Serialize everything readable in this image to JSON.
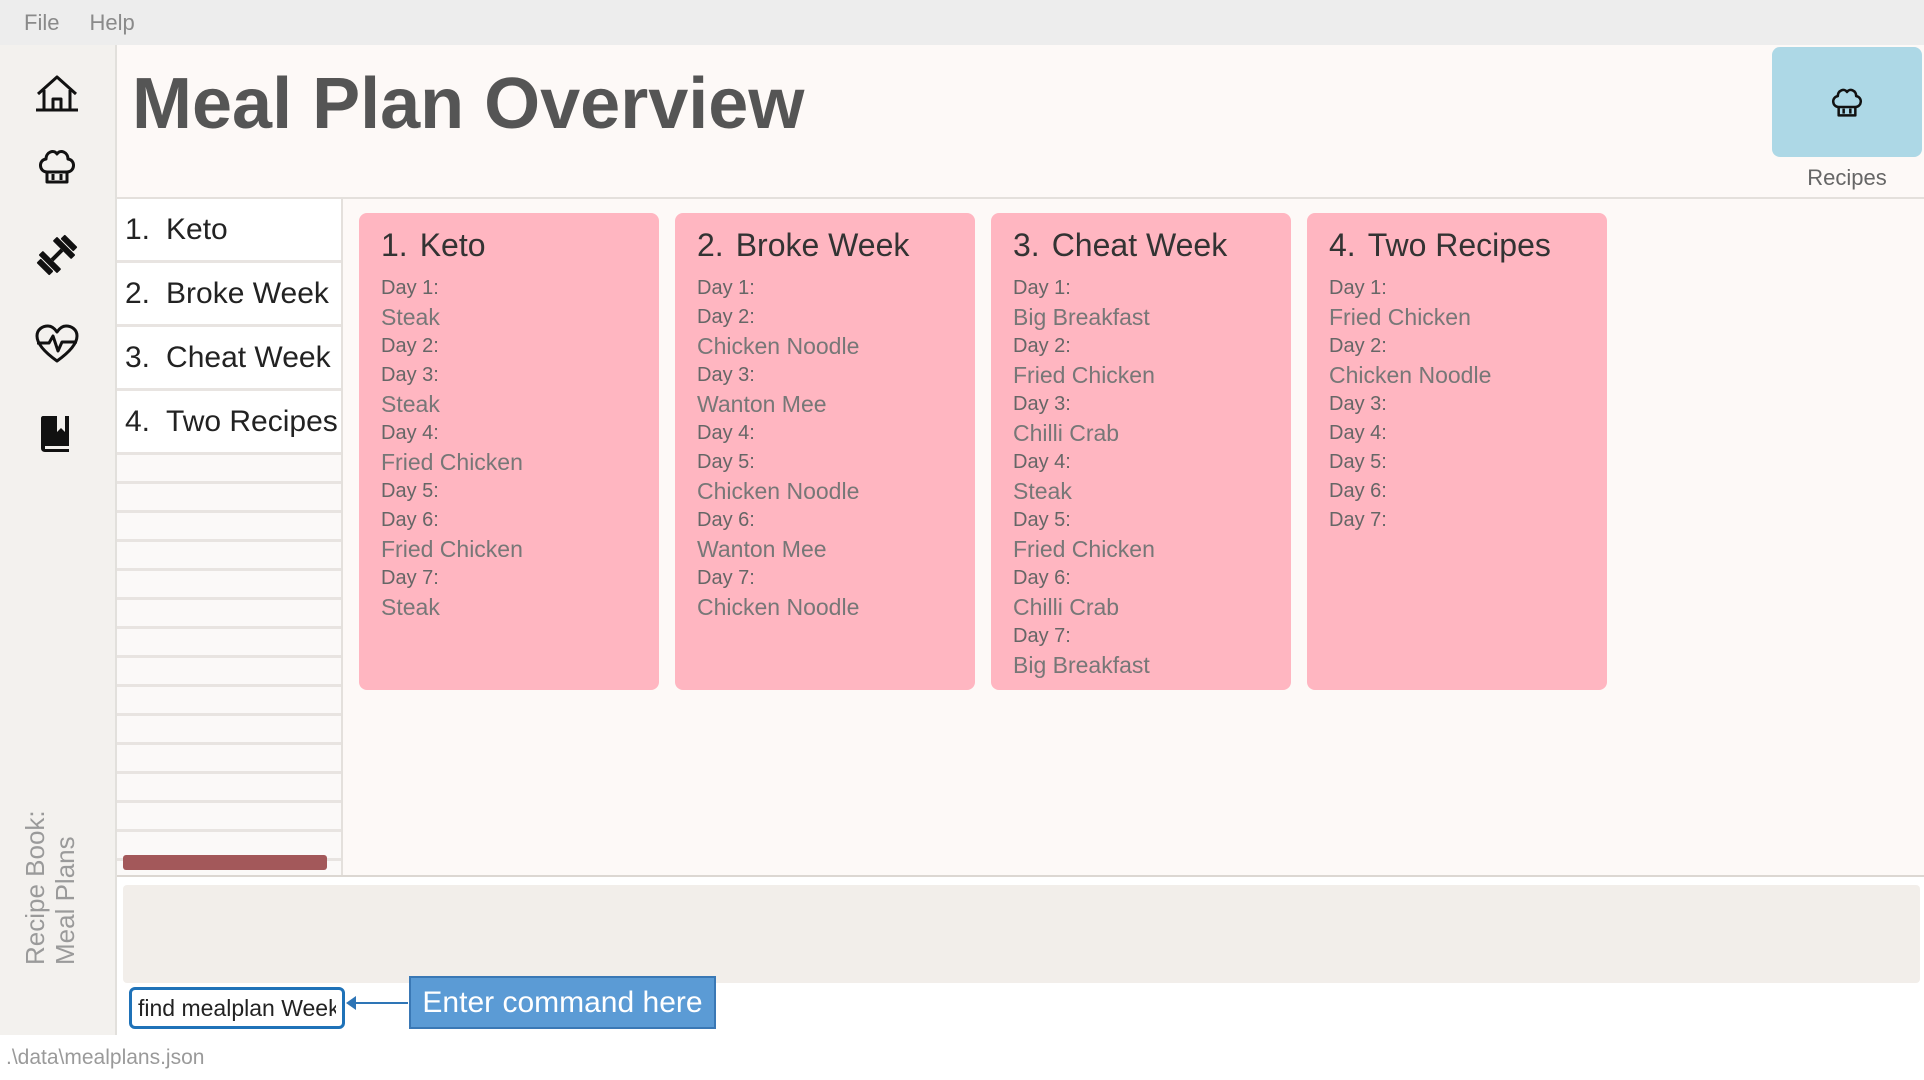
{
  "menu": {
    "items": [
      "File",
      "Help"
    ]
  },
  "sidebar": {
    "icons": [
      "home-icon",
      "chef-hat-icon",
      "dumbbell-icon",
      "heartbeat-icon",
      "book-icon"
    ],
    "caption_line1": "Recipe Book:",
    "caption_line2": "Meal Plans"
  },
  "header": {
    "title": "Meal Plan Overview",
    "recipes_button_label": "Recipes"
  },
  "plan_list": [
    {
      "num": "1.",
      "name": "Keto"
    },
    {
      "num": "2.",
      "name": "Broke Week"
    },
    {
      "num": "3.",
      "name": "Cheat Week"
    },
    {
      "num": "4.",
      "name": "Two Recipes"
    }
  ],
  "cards": [
    {
      "num": "1.",
      "name": "Keto",
      "lines": [
        {
          "type": "day",
          "text": "Day 1:"
        },
        {
          "type": "dish",
          "text": "Steak"
        },
        {
          "type": "day",
          "text": "Day 2:"
        },
        {
          "type": "day",
          "text": "Day 3:"
        },
        {
          "type": "dish",
          "text": "Steak"
        },
        {
          "type": "day",
          "text": "Day 4:"
        },
        {
          "type": "dish",
          "text": "Fried Chicken"
        },
        {
          "type": "day",
          "text": "Day 5:"
        },
        {
          "type": "day",
          "text": "Day 6:"
        },
        {
          "type": "dish",
          "text": "Fried Chicken"
        },
        {
          "type": "day",
          "text": "Day 7:"
        },
        {
          "type": "dish",
          "text": "Steak"
        }
      ]
    },
    {
      "num": "2.",
      "name": "Broke Week",
      "lines": [
        {
          "type": "day",
          "text": "Day 1:"
        },
        {
          "type": "day",
          "text": "Day 2:"
        },
        {
          "type": "dish",
          "text": "Chicken Noodle"
        },
        {
          "type": "day",
          "text": "Day 3:"
        },
        {
          "type": "dish",
          "text": "Wanton Mee"
        },
        {
          "type": "day",
          "text": "Day 4:"
        },
        {
          "type": "day",
          "text": "Day 5:"
        },
        {
          "type": "dish",
          "text": "Chicken Noodle"
        },
        {
          "type": "day",
          "text": "Day 6:"
        },
        {
          "type": "dish",
          "text": "Wanton Mee"
        },
        {
          "type": "day",
          "text": "Day 7:"
        },
        {
          "type": "dish",
          "text": "Chicken Noodle"
        }
      ]
    },
    {
      "num": "3.",
      "name": "Cheat Week",
      "lines": [
        {
          "type": "day",
          "text": "Day 1:"
        },
        {
          "type": "dish",
          "text": "Big Breakfast"
        },
        {
          "type": "day",
          "text": "Day 2:"
        },
        {
          "type": "dish",
          "text": "Fried Chicken"
        },
        {
          "type": "day",
          "text": "Day 3:"
        },
        {
          "type": "dish",
          "text": "Chilli Crab"
        },
        {
          "type": "day",
          "text": "Day 4:"
        },
        {
          "type": "dish",
          "text": "Steak"
        },
        {
          "type": "day",
          "text": "Day 5:"
        },
        {
          "type": "dish",
          "text": "Fried Chicken"
        },
        {
          "type": "day",
          "text": "Day 6:"
        },
        {
          "type": "dish",
          "text": "Chilli Crab"
        },
        {
          "type": "day",
          "text": "Day 7:"
        },
        {
          "type": "dish",
          "text": "Big Breakfast"
        }
      ]
    },
    {
      "num": "4.",
      "name": "Two Recipes",
      "lines": [
        {
          "type": "day",
          "text": "Day 1:"
        },
        {
          "type": "dish",
          "text": "Fried Chicken"
        },
        {
          "type": "day",
          "text": "Day 2:"
        },
        {
          "type": "dish",
          "text": "Chicken Noodle"
        },
        {
          "type": "day",
          "text": "Day 3:"
        },
        {
          "type": "day",
          "text": "Day 4:"
        },
        {
          "type": "day",
          "text": "Day 5:"
        },
        {
          "type": "day",
          "text": "Day 6:"
        },
        {
          "type": "day",
          "text": "Day 7:"
        }
      ]
    }
  ],
  "command": {
    "value": "find mealplan Week",
    "callout": "Enter command here"
  },
  "status": {
    "path": ".\\data\\mealplans.json"
  },
  "colors": {
    "card_bg": "#ffb6c1",
    "recipes_button_bg": "#add8e6",
    "accent_blue": "#1f72b8",
    "callout_bg": "#5b9bd5",
    "scrollbar": "#a3585a"
  }
}
